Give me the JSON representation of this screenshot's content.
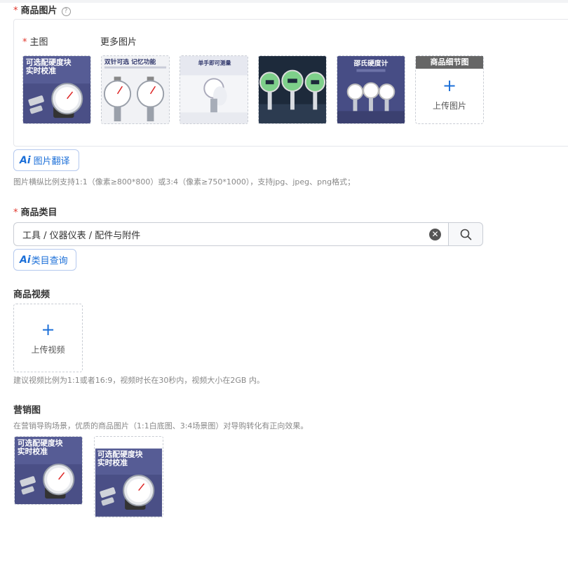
{
  "required_mark": "*",
  "images": {
    "label": "商品图片",
    "help_icon": "?",
    "main_label": "主图",
    "more_label": "更多图片",
    "thumb1_text1": "可选配硬度块",
    "thumb1_text2": "实时校准",
    "thumb2_text": "双针可选 记忆功能",
    "thumb3_text": "单手即可测量",
    "thumb5_text": "邵氏硬度计",
    "detail_header": "商品细节图",
    "upload_plus": "+",
    "upload_label": "上传图片",
    "ai_mark": "Ai",
    "translate_label": "图片翻译",
    "hint": "图片横纵比例支持1:1（像素≥800*800）或3:4（像素≥750*1000），支持jpg、jpeg、png格式；"
  },
  "category": {
    "label": "商品类目",
    "value": "工具 / 仪器仪表 / 配件与附件",
    "clear_icon": "✕",
    "ai_mark": "Ai",
    "query_label": "类目查询"
  },
  "video": {
    "label": "商品视频",
    "upload_plus": "+",
    "upload_label": "上传视频",
    "hint": "建议视频比例为1:1或者16:9，视频时长在30秒内，视频大小在2GB 内。"
  },
  "marketing": {
    "label": "营销图",
    "hint": "在营销导购场景，优质的商品图片（1:1白底图、3:4场景图）对导购转化有正向效果。",
    "img1_text1": "可选配硬度块",
    "img1_text2": "实时校准",
    "img2_text1": "可选配硬度块",
    "img2_text2": "实时校准"
  },
  "colors": {
    "accent": "#1b6fd8",
    "required": "#e0352b",
    "thumb_bg": "#4a4f86"
  }
}
